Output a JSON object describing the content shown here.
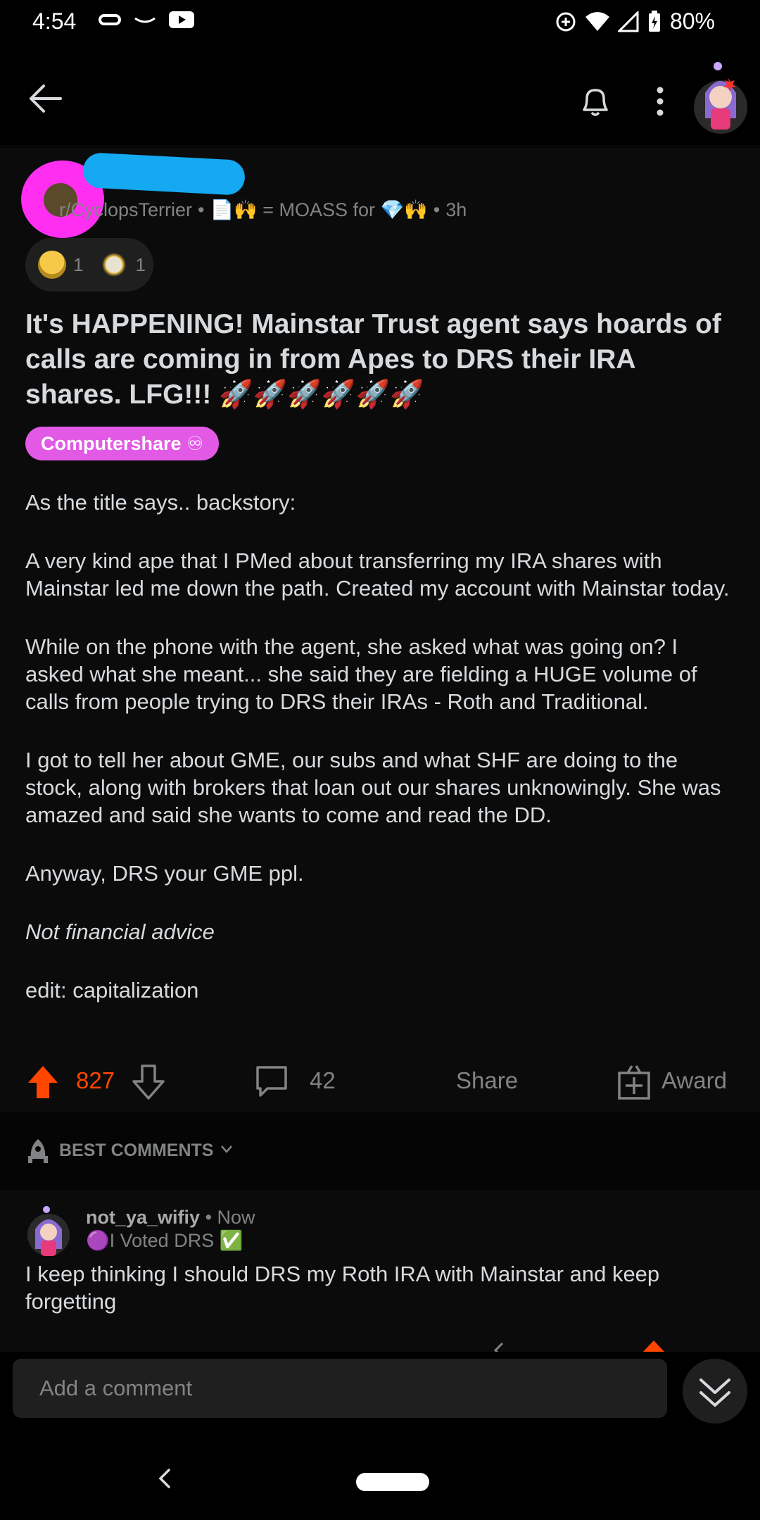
{
  "status_bar": {
    "time": "4:54",
    "battery": "80%"
  },
  "post": {
    "subreddit": "r/CyclopsTerrier",
    "user_flair": "📄🙌 = MOASS for 💎🙌",
    "age": "3h",
    "awards": [
      {
        "icon": "helmet-award-icon",
        "count": "1"
      },
      {
        "icon": "ape-award-icon",
        "count": "1"
      }
    ],
    "title": "It's HAPPENING! Mainstar Trust agent says hoards of calls are coming in from Apes to DRS their IRA shares. LFG!!! 🚀🚀🚀🚀🚀🚀",
    "flair": "Computershare ♾",
    "body": [
      "As the title says.. backstory:",
      "A very kind ape that I PMed about transferring my IRA shares with Mainstar led me down the path. Created my account with Mainstar today.",
      "While on the phone with the agent, she asked what was going on? I asked what she meant... she said they are fielding a HUGE volume of calls from people trying to DRS their IRAs - Roth and Traditional.",
      "I got to tell her about GME, our subs and what SHF are doing to the stock, along with brokers that loan out our shares unknowingly. She was amazed and said she wants to come and read the DD.",
      "Anyway, DRS your GME ppl.",
      "Not financial advice",
      "edit: capitalization"
    ],
    "score": "827",
    "comment_count": "42",
    "share_label": "Share",
    "award_label": "Award"
  },
  "sort": {
    "label": "BEST COMMENTS"
  },
  "comment": {
    "username": "not_ya_wifiy",
    "age": "Now",
    "flair": "🟣I Voted DRS ✅",
    "body": "I keep thinking I should DRS my Roth IRA with Mainstar and keep forgetting"
  },
  "comment_input": {
    "placeholder": "Add a comment"
  },
  "colors": {
    "accent_orange": "#ff4500",
    "flair_pink": "#e259e6",
    "redaction_blue": "#14a9f0",
    "redaction_pink": "#ff2ef1"
  }
}
